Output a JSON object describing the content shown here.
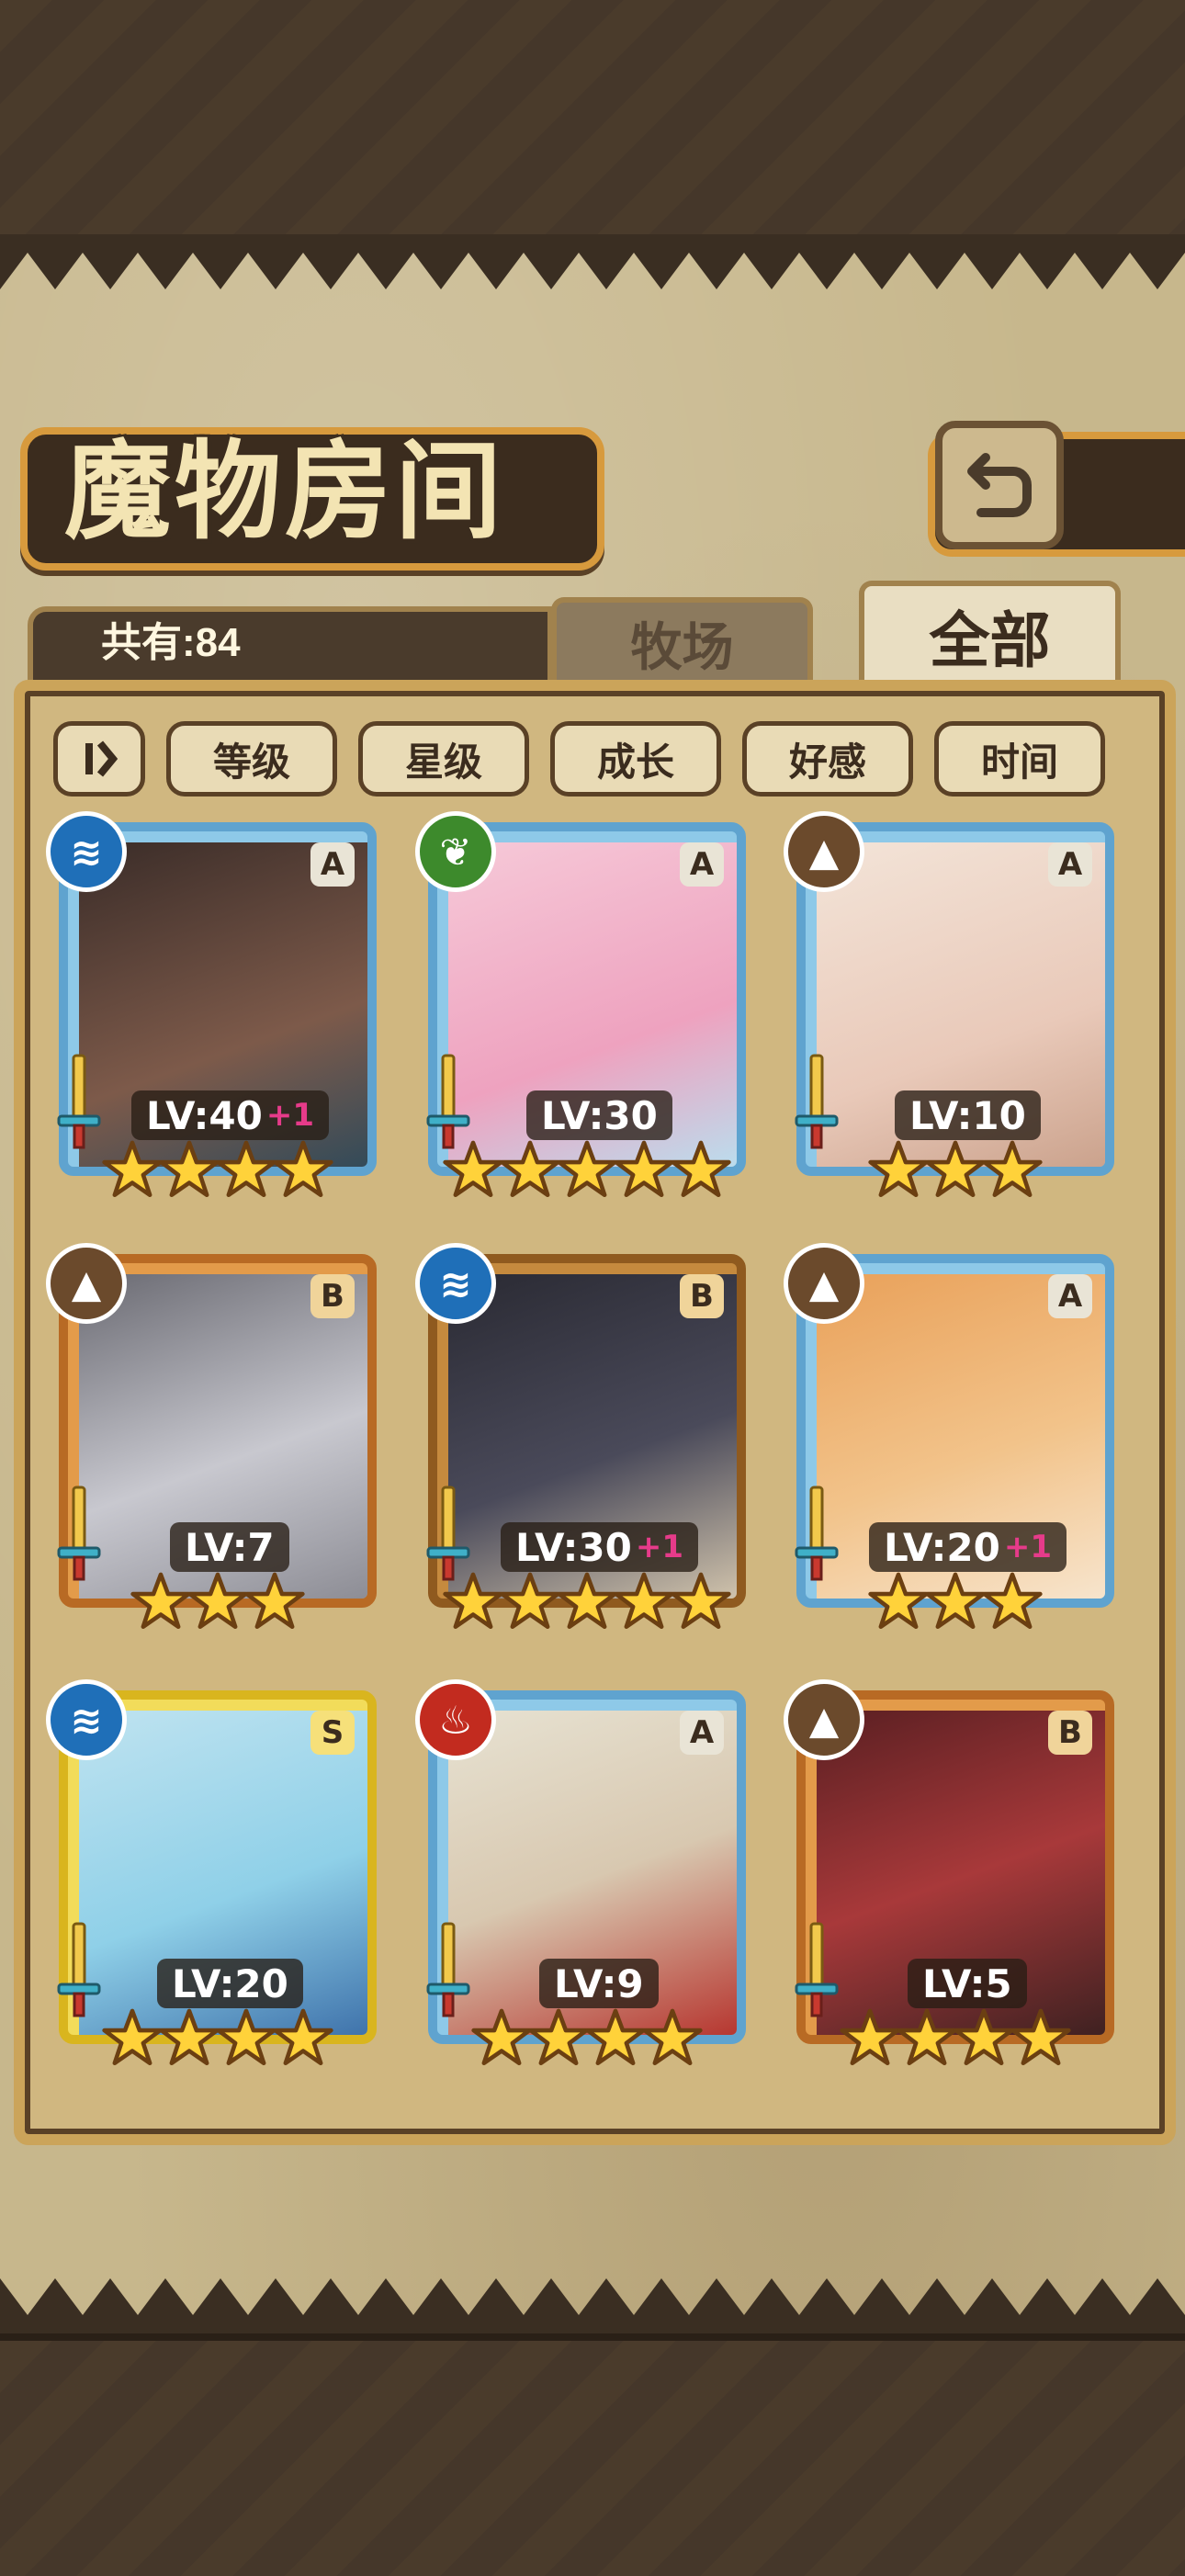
{
  "title": "魔物房间",
  "count_label": "共有:84",
  "tabs": [
    {
      "label": "牧场",
      "active": false
    },
    {
      "label": "全部",
      "active": true
    }
  ],
  "filters": [
    "等级",
    "星级",
    "成长",
    "好感",
    "时间"
  ],
  "cards": [
    {
      "level": "LV:40",
      "bonus": "+1",
      "rank": "A",
      "element": "water",
      "stars": 4,
      "frame": "blue"
    },
    {
      "level": "LV:30",
      "bonus": "",
      "rank": "A",
      "element": "wood",
      "stars": 5,
      "frame": "blue"
    },
    {
      "level": "LV:10",
      "bonus": "",
      "rank": "A",
      "element": "earth",
      "stars": 3,
      "frame": "blue"
    },
    {
      "level": "LV:7",
      "bonus": "",
      "rank": "B",
      "element": "earth",
      "stars": 3,
      "frame": "orange"
    },
    {
      "level": "LV:30",
      "bonus": "+1",
      "rank": "B",
      "element": "water",
      "stars": 5,
      "frame": "bronze"
    },
    {
      "level": "LV:20",
      "bonus": "+1",
      "rank": "A",
      "element": "earth",
      "stars": 3,
      "frame": "blue"
    },
    {
      "level": "LV:20",
      "bonus": "",
      "rank": "S",
      "element": "water",
      "stars": 4,
      "frame": "gold"
    },
    {
      "level": "LV:9",
      "bonus": "",
      "rank": "A",
      "element": "fire",
      "stars": 4,
      "frame": "blue"
    },
    {
      "level": "LV:5",
      "bonus": "",
      "rank": "B",
      "element": "earth",
      "stars": 4,
      "frame": "orange"
    }
  ],
  "element_colors": {
    "water": "#1f6fb8",
    "wood": "#3d8a2c",
    "earth": "#6b4a2c",
    "fire": "#c22b1f"
  },
  "icons": {
    "back": "back-arrow-icon",
    "sort": "sort-toggle-icon",
    "star": "star-icon",
    "sword": "sword-icon"
  }
}
